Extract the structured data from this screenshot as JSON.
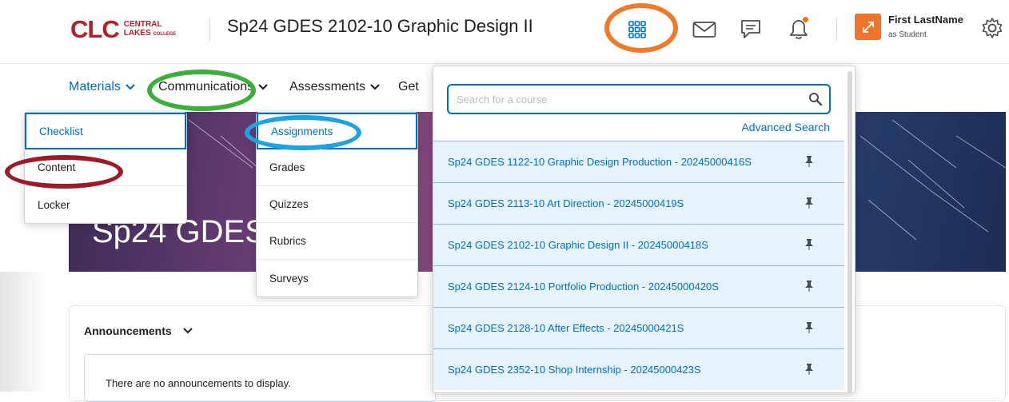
{
  "header": {
    "logo_mark": "CLC",
    "logo_line1": "CENTRAL",
    "logo_line2": "LAKES",
    "logo_line3": "COLLEGE",
    "course_title": "Sp24 GDES 2102-10 Graphic Design II",
    "user_name": "First LastName",
    "user_role": "as Student",
    "icons": [
      "grid-icon",
      "mail-icon",
      "chat-icon",
      "bell-icon",
      "settings-icon"
    ],
    "accent_color": "#006fbf",
    "brand_color": "#b4202a"
  },
  "nav": {
    "materials": "Materials",
    "communication": "Communications",
    "assessments": "Assessments",
    "get": "Get"
  },
  "materials_menu": {
    "items": [
      "Checklist",
      "Content",
      "Locker"
    ],
    "selected": "Checklist"
  },
  "assessments_menu": {
    "items": [
      "Assignments",
      "Grades",
      "Quizzes",
      "Rubrics",
      "Surveys"
    ],
    "selected": "Assignments"
  },
  "banner": {
    "title": "Sp24 GDES 2"
  },
  "announcements": {
    "title": "Announcements",
    "empty_text": "There are no announcements to display."
  },
  "course_selector": {
    "search_placeholder": "Search for a course",
    "advanced_search": "Advanced Search",
    "courses": [
      "Sp24 GDES 1122-10 Graphic Design Production - 20245000416S",
      "Sp24 GDES 2113-10 Art Direction - 20245000419S",
      "Sp24 GDES 2102-10 Graphic Design II - 20245000418S",
      "Sp24 GDES 2124-10 Portfolio Production - 20245000420S",
      "Sp24 GDES 2128-10 After Effects - 20245000421S",
      "Sp24 GDES 2352-10 Shop Internship - 20245000423S"
    ]
  },
  "highlights": {
    "orange": "#f07a28",
    "green": "#3cae3c",
    "blue": "#1fa3e0",
    "maroon": "#9c1b2b"
  }
}
